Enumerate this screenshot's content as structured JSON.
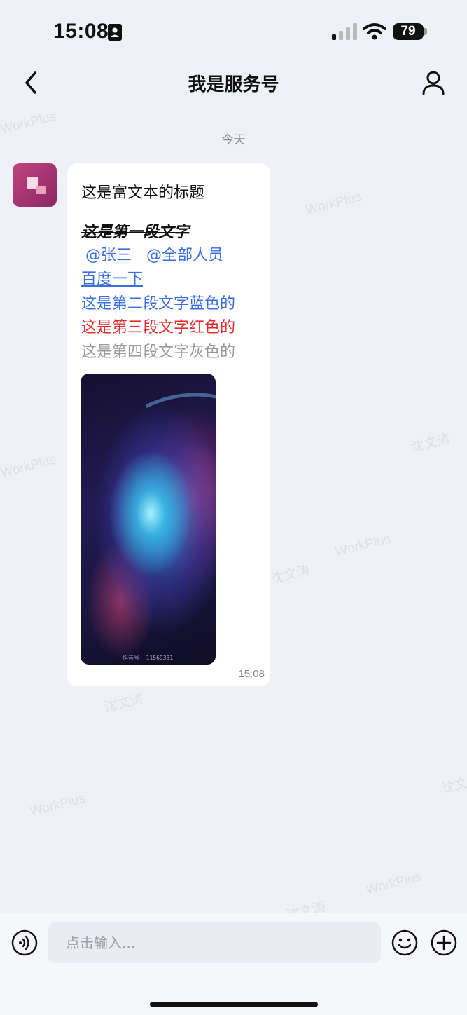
{
  "status_bar": {
    "time": "15:08",
    "battery": "79"
  },
  "header": {
    "title": "我是服务号"
  },
  "chat": {
    "date_separator": "今天",
    "message": {
      "title": "这是富文本的标题",
      "strike_line": "这是第一段文字",
      "mentions": [
        "@张三",
        "@全部人员"
      ],
      "link": "百度一下",
      "blue_line": "这是第二段文字蓝色的",
      "red_line": "这是第三段文字红色的",
      "gray_line": "这是第四段文字灰色的",
      "image_caption": "抖音号: 11569331",
      "time": "15:08"
    }
  },
  "watermarks": {
    "brand": "WorkPlus",
    "user": "沈文涛"
  },
  "input": {
    "placeholder": "点击输入..."
  },
  "colors": {
    "link_blue": "#3a6fe0",
    "red": "#e02e2e",
    "gray": "#999999",
    "avatar": "#b03a74"
  },
  "icons": [
    "id-badge-icon",
    "signal-icon",
    "wifi-icon",
    "back-chevron-icon",
    "person-icon",
    "voice-icon",
    "emoji-icon",
    "plus-icon"
  ]
}
